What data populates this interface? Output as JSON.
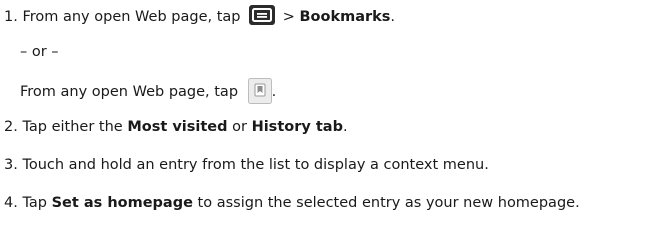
{
  "steps": [
    {
      "number": "1.",
      "parts": {
        "before_icon": "From any open Web page, tap",
        "separator": ">",
        "bold": "Bookmarks",
        "end": "."
      },
      "icon": "menu-icon"
    },
    {
      "or_text": "– or –"
    },
    {
      "parts": {
        "before_icon": "From any open Web page, tap",
        "end": "."
      },
      "icon": "bookmark-icon"
    },
    {
      "number": "2.",
      "parts": {
        "a": "Tap either the",
        "bold1": "Most visited",
        "b": "or",
        "bold2": "History tab",
        "end": "."
      }
    },
    {
      "number": "3.",
      "parts": {
        "text": "Touch and hold an entry from the list to display a context menu."
      }
    },
    {
      "number": "4.",
      "parts": {
        "a": "Tap",
        "bold": "Set as homepage",
        "b": "to assign the selected entry as your new homepage."
      }
    }
  ],
  "colors": {
    "text": "#1a1a1a",
    "menu_icon_bg": "#2b2b2b",
    "menu_icon_fg": "#ffffff",
    "bookmark_icon_bg": "#e9e9e9"
  }
}
